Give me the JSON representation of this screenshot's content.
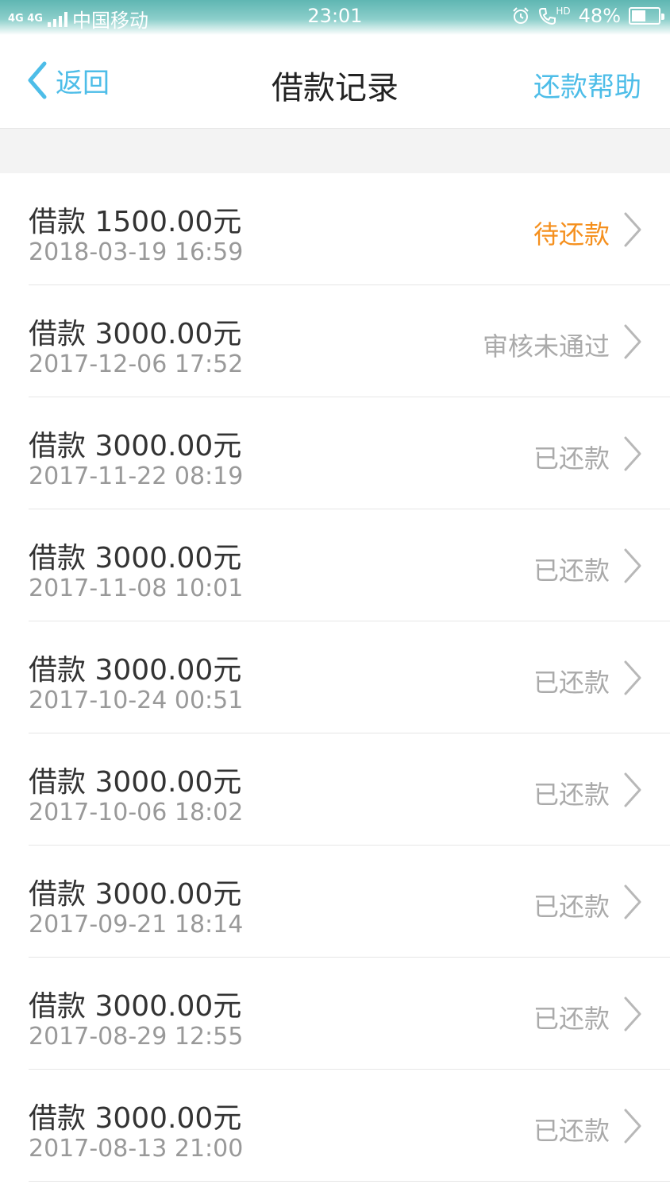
{
  "status_bar": {
    "network": "4G 4G",
    "carrier": "中国移动",
    "time": "23:01",
    "hd": "HD",
    "battery": "48%"
  },
  "nav": {
    "back_label": "返回",
    "title": "借款记录",
    "help_label": "还款帮助"
  },
  "records": [
    {
      "amount": "借款 1500.00元",
      "date": "2018-03-19 16:59",
      "status": "待还款",
      "pending": true
    },
    {
      "amount": "借款 3000.00元",
      "date": "2017-12-06 17:52",
      "status": "审核未通过",
      "pending": false
    },
    {
      "amount": "借款 3000.00元",
      "date": "2017-11-22 08:19",
      "status": "已还款",
      "pending": false
    },
    {
      "amount": "借款 3000.00元",
      "date": "2017-11-08 10:01",
      "status": "已还款",
      "pending": false
    },
    {
      "amount": "借款 3000.00元",
      "date": "2017-10-24 00:51",
      "status": "已还款",
      "pending": false
    },
    {
      "amount": "借款 3000.00元",
      "date": "2017-10-06 18:02",
      "status": "已还款",
      "pending": false
    },
    {
      "amount": "借款 3000.00元",
      "date": "2017-09-21 18:14",
      "status": "已还款",
      "pending": false
    },
    {
      "amount": "借款 3000.00元",
      "date": "2017-08-29 12:55",
      "status": "已还款",
      "pending": false
    },
    {
      "amount": "借款 3000.00元",
      "date": "2017-08-13 21:00",
      "status": "已还款",
      "pending": false
    }
  ],
  "colors": {
    "accent": "#4dbde8",
    "pending": "#f5901e",
    "muted": "#aaaaaa"
  },
  "icons": {
    "back": "chevron-left-icon",
    "row": "chevron-right-icon",
    "alarm": "alarm-icon",
    "call": "hd-call-icon",
    "battery": "battery-icon",
    "signal": "signal-icon"
  }
}
